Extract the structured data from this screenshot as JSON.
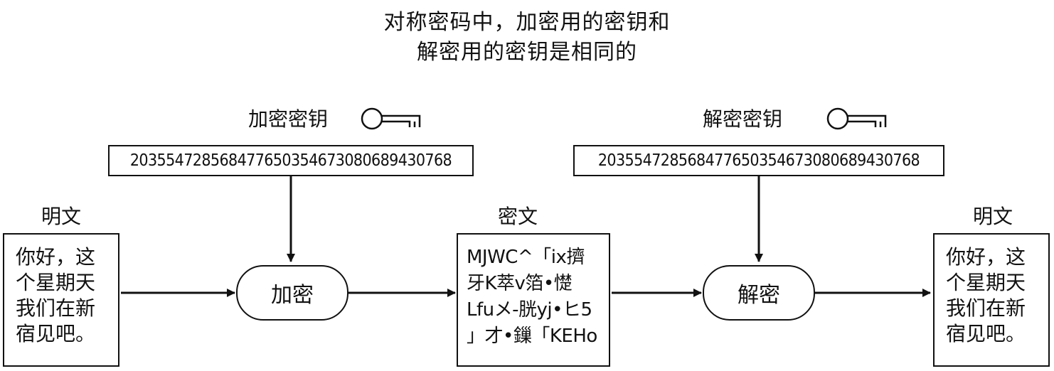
{
  "title": {
    "line1": "对称密码中，加密用的密钥和",
    "line2": "解密用的密钥是相同的"
  },
  "encryption_key": {
    "label": "加密密钥",
    "value": "20355472856847765035467308068943076​8",
    "icon": "key-icon"
  },
  "decryption_key": {
    "label": "解密密钥",
    "value": "203554728568477650354673080689430768",
    "icon": "key-icon"
  },
  "plaintext_in": {
    "label": "明文",
    "lines": [
      "你好，这",
      "个星期天",
      "我们在新",
      "宿见吧。"
    ]
  },
  "ciphertext": {
    "label": "密文",
    "lines": [
      "MJWC^「ix擠",
      "牙K萃v箔•憷",
      "Lfuメ-胱yj•ヒ5",
      "」才•鏁「KEHo"
    ]
  },
  "plaintext_out": {
    "label": "明文",
    "lines": [
      "你好，这",
      "个星期天",
      "我们在新",
      "宿见吧。"
    ]
  },
  "process_encrypt": {
    "label": "加密"
  },
  "process_decrypt": {
    "label": "解密"
  }
}
